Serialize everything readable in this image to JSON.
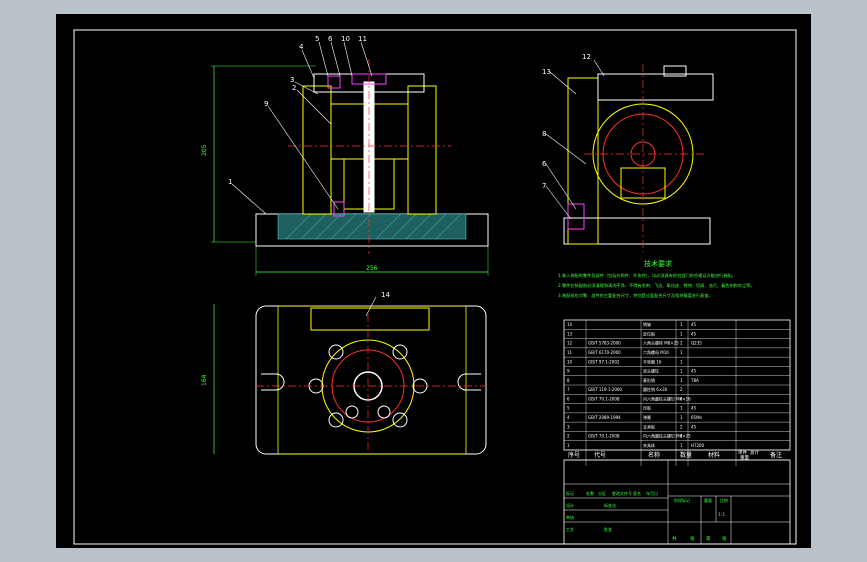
{
  "drawing": {
    "balloons_front": [
      "4",
      "5",
      "6",
      "10",
      "11",
      "3",
      "2",
      "9",
      "1"
    ],
    "balloons_side": [
      "12",
      "13",
      "8",
      "6",
      "7"
    ],
    "balloon_top": "14",
    "dim_height": "205",
    "dim_width": "256",
    "dim_top_height": "164"
  },
  "tech_requirements": {
    "title": "技术要求",
    "lines": [
      "1.装入装配的零件及部件（包括外购件、外协件），均必须具有检验部门的合格证方能进行装配。",
      "2.零件在装配前必须清理和清洗干净，不得有毛刺、飞边、氧化皮、锈蚀、切屑、油污、着色剂和灰尘等。",
      "3.装配前应对零、部件的主要配合尺寸，特别是过盈配合尺寸及相关精度进行复查。"
    ]
  },
  "bom": {
    "rows": [
      [
        "14",
        "",
        "销轴",
        "1",
        "45",
        ""
      ],
      [
        "13",
        "",
        "定位板",
        "1",
        "45",
        ""
      ],
      [
        "12",
        "GB/T 5783-2000",
        "六角头螺栓 M8×25",
        "2",
        "Q235",
        ""
      ],
      [
        "11",
        "GB/T 6170-2000",
        "六角螺母 M16",
        "1",
        "",
        ""
      ],
      [
        "10",
        "GB/T 97.1-2002",
        "平垫圈 16",
        "1",
        "",
        ""
      ],
      [
        "9",
        "",
        "双头螺柱",
        "1",
        "45",
        ""
      ],
      [
        "8",
        "",
        "菱形销",
        "1",
        "T8A",
        ""
      ],
      [
        "7",
        "GB/T 119.1-2000",
        "圆柱销 6×30",
        "2",
        "",
        ""
      ],
      [
        "6",
        "GB/T 70.1-2008",
        "内六角圆柱头螺钉 M6×16",
        "4",
        "",
        ""
      ],
      [
        "5",
        "",
        "压板",
        "1",
        "45",
        ""
      ],
      [
        "4",
        "GB/T 2089-1994",
        "弹簧",
        "1",
        "65Mn",
        ""
      ],
      [
        "3",
        "",
        "支承板",
        "2",
        "45",
        ""
      ],
      [
        "2",
        "GB/T 70.1-2008",
        "内六角圆柱头螺钉 M8×25",
        "4",
        "",
        ""
      ],
      [
        "1",
        "",
        "夹具体",
        "1",
        "HT200",
        ""
      ]
    ],
    "header": {
      "seq": "序号",
      "code": "代号",
      "name": "名称",
      "qty": "数量",
      "material": "材料",
      "unit_weight": "单件",
      "total_weight": "总计",
      "weight": "重量",
      "remark": "备注"
    }
  },
  "title_block": {
    "labels": [
      "标记",
      "处数",
      "分区",
      "更改文件号",
      "签名",
      "年月日",
      "设计",
      "标准化",
      "审核",
      "工艺",
      "批准",
      "阶段标记",
      "重量",
      "比例"
    ],
    "scale": "1:1",
    "sheet": [
      "共",
      "张",
      "第",
      "张"
    ]
  },
  "colors": {
    "frame": "#ffffff",
    "part": "#ffff00",
    "hatch": "#40d0d0",
    "centerline": "#ff3030",
    "balloon": "#ffffff",
    "dimension": "#40ff40",
    "text_green": "#40ff40",
    "component": "#ff40ff"
  }
}
